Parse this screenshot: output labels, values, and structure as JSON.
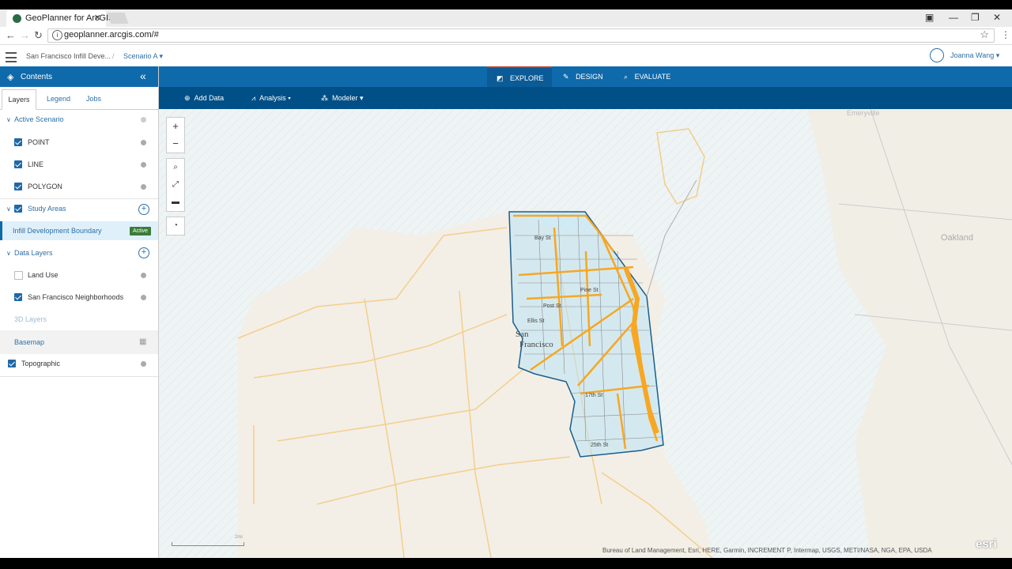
{
  "browser": {
    "tab_title": "GeoPlanner for ArcGIS",
    "url": "geoplanner.arcgis.com/#"
  },
  "header": {
    "project": "San Francisco Infill Deve...",
    "separator": "/",
    "scenario": "Scenario A",
    "user": "Joanna Wang"
  },
  "sidebar": {
    "title": "Contents",
    "tabs": [
      "Layers",
      "Legend",
      "Jobs"
    ],
    "active_scenario": "Active Scenario",
    "scenario_layers": [
      "POINT",
      "LINE",
      "POLYGON"
    ],
    "study_areas": "Study Areas",
    "study_item": "Infill Development Boundary",
    "active_badge": "Active",
    "data_layers": "Data Layers",
    "land_use": "Land Use",
    "neighborhoods": "San Francisco Neighborhoods",
    "layers_3d": "3D Layers",
    "basemap": "Basemap",
    "topographic": "Topographic"
  },
  "modes": [
    "EXPLORE",
    "DESIGN",
    "EVALUATE"
  ],
  "toolbar": {
    "add_data": "Add Data",
    "analysis": "Analysis",
    "modeler": "Modeler"
  },
  "map": {
    "attribution": "Bureau of Land Management, Esri, HERE, Garmin, INCREMENT P, Intermap, USGS, METI/NASA, NGA, EPA, USDA",
    "logo": "esri",
    "labels": {
      "san": "San",
      "francisco": "Francisco",
      "oakland": "Oakland",
      "emeryville": "Emeryville",
      "bay_st": "Bay St",
      "post_st": "Post St",
      "ellis_st": "Ellis St",
      "pine_st": "Pine St",
      "ave_25": "25th St",
      "st_17": "17th St"
    },
    "scale": "2mi"
  },
  "colors": {
    "brand_blue": "#0f6aac",
    "toolbar_blue": "#004f86",
    "boundary_fill": "#b9e3f5",
    "neighborhood_orange": "#f7a722",
    "active_green": "#3a7d3a"
  }
}
